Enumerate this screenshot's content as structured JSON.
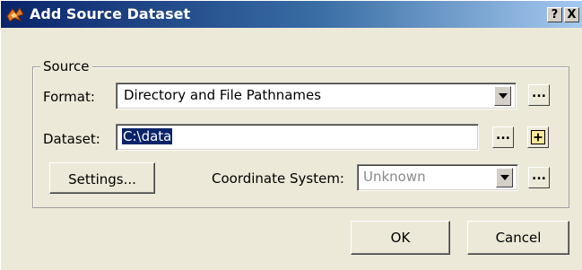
{
  "window": {
    "title": "Add Source Dataset",
    "help_label": "?",
    "close_label": "X"
  },
  "source_group": {
    "legend": "Source",
    "format_label": "Format:",
    "format_value": "Directory and File Pathnames",
    "dataset_label": "Dataset:",
    "dataset_value": "C:\\data",
    "browse_label": "...",
    "settings_label": "Settings...",
    "coord_label": "Coordinate System:",
    "coord_value": "Unknown"
  },
  "footer": {
    "ok_label": "OK",
    "cancel_label": "Cancel"
  },
  "icons": {
    "title_icon": "fme-app-icon",
    "dropdown": "chevron-down-icon",
    "add": "plus-icon"
  }
}
